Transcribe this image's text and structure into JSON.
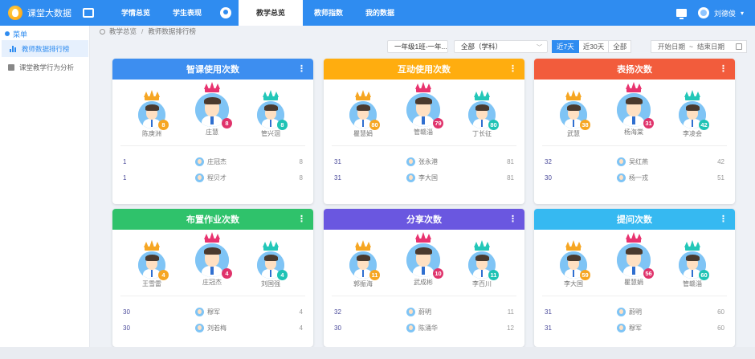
{
  "app": {
    "title": "课堂大数据"
  },
  "nav": [
    {
      "label": "学情总览",
      "active": false
    },
    {
      "label": "学生表现",
      "active": false
    },
    {
      "label": "教学总览",
      "active": true
    },
    {
      "label": "教师指数",
      "active": false
    },
    {
      "label": "我的数据",
      "active": false
    }
  ],
  "user": {
    "name": "刘德俊"
  },
  "sidebar": {
    "title": "菜单",
    "items": [
      {
        "label": "教师数据排行榜",
        "active": true
      },
      {
        "label": "课堂教学行为分析",
        "active": false
      }
    ]
  },
  "breadcrumb": {
    "root": "教学总览",
    "sep": "/",
    "current": "教师数据排行榜"
  },
  "filters": {
    "class": "一年级1班-一年...",
    "subject": "全部（学科）",
    "ranges": [
      "近7天",
      "近30天",
      "全部"
    ],
    "active_range": "近7天",
    "start_placeholder": "开始日期",
    "range_sep": "~",
    "end_placeholder": "结束日期"
  },
  "colors": {
    "blue": "#3d8ef0",
    "orange": "#ffad0f",
    "red": "#f25c3c",
    "green": "#2fc26b",
    "purple": "#6a57e0",
    "cyan": "#36b9f1",
    "crown_gold": "#f6a623",
    "crown_pink": "#e8336f",
    "crown_teal": "#23c7b8",
    "badge_orange": "#f6a623",
    "badge_pink": "#e0336b",
    "badge_teal": "#1fc3b5"
  },
  "cards": [
    {
      "title": "智课使用次数",
      "color": "blue",
      "top": [
        {
          "name": "陈庚洲",
          "value": "8"
        },
        {
          "name": "庄慧",
          "value": "8"
        },
        {
          "name": "管兴洄",
          "value": "8"
        }
      ],
      "rows": [
        {
          "rank": "1",
          "name": "庄冠杰",
          "value": "8"
        },
        {
          "rank": "1",
          "name": "程贝才",
          "value": "8"
        }
      ]
    },
    {
      "title": "互动使用次数",
      "color": "orange",
      "top": [
        {
          "name": "瞿慧娟",
          "value": "80"
        },
        {
          "name": "管赣淄",
          "value": "79"
        },
        {
          "name": "丁长征",
          "value": "80"
        }
      ],
      "rows": [
        {
          "rank": "31",
          "name": "张永港",
          "value": "81"
        },
        {
          "rank": "31",
          "name": "李大国",
          "value": "81"
        }
      ]
    },
    {
      "title": "表扬次数",
      "color": "red",
      "top": [
        {
          "name": "武慧",
          "value": "38"
        },
        {
          "name": "杨海棠",
          "value": "31"
        },
        {
          "name": "李凌会",
          "value": "42"
        }
      ],
      "rows": [
        {
          "rank": "32",
          "name": "吴红燕",
          "value": "42"
        },
        {
          "rank": "30",
          "name": "杨一戎",
          "value": "51"
        }
      ]
    },
    {
      "title": "布置作业次数",
      "color": "green",
      "top": [
        {
          "name": "王雪雷",
          "value": "4"
        },
        {
          "name": "庄冠杰",
          "value": "4"
        },
        {
          "name": "刘国强",
          "value": "4"
        }
      ],
      "rows": [
        {
          "rank": "30",
          "name": "穆军",
          "value": "4"
        },
        {
          "rank": "30",
          "name": "刘若梅",
          "value": "4"
        }
      ]
    },
    {
      "title": "分享次数",
      "color": "purple",
      "top": [
        {
          "name": "郭振海",
          "value": "11"
        },
        {
          "name": "武成彬",
          "value": "10"
        },
        {
          "name": "李百川",
          "value": "11"
        }
      ],
      "rows": [
        {
          "rank": "32",
          "name": "蔚明",
          "value": "11"
        },
        {
          "rank": "30",
          "name": "陈涌华",
          "value": "12"
        }
      ]
    },
    {
      "title": "提问次数",
      "color": "cyan",
      "top": [
        {
          "name": "李大国",
          "value": "59"
        },
        {
          "name": "瞿慧娟",
          "value": "56"
        },
        {
          "name": "管赣淄",
          "value": "60"
        }
      ],
      "rows": [
        {
          "rank": "31",
          "name": "蔚明",
          "value": "60"
        },
        {
          "rank": "31",
          "name": "穆军",
          "value": "60"
        }
      ]
    }
  ]
}
